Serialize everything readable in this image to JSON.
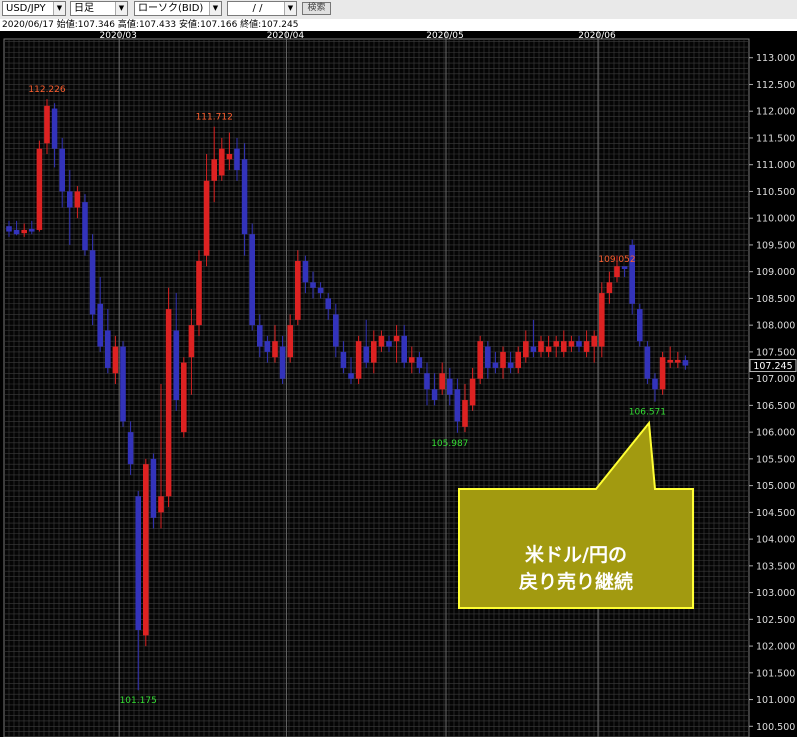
{
  "toolbar": {
    "symbol": "USD/JPY",
    "period": "日足",
    "chart_style": "ローソク(BID)",
    "date": "/ /",
    "search_label": "検索"
  },
  "info": {
    "date": "2020/06/17",
    "open_label": "始値:",
    "open": "107.346",
    "high_label": "高値:",
    "high": "107.433",
    "low_label": "安値:",
    "low": "107.166",
    "close_label": "終値:",
    "close": "107.245"
  },
  "callout": {
    "line1": "米ドル/円の",
    "line2": "戻り売り継続"
  },
  "colors": {
    "up": "#dd2222",
    "down": "#3333bb",
    "high_label": "#ff6030",
    "low_label": "#33dd33",
    "callout_bg": "#a29a10",
    "callout_border": "#ffff33",
    "grid": "#3c3c3c",
    "month_line": "#6a6a6a"
  },
  "chart_data": {
    "type": "candlestick",
    "xlabel": "",
    "ylabel": "",
    "grid": true,
    "ylim": [
      100.3,
      113.35
    ],
    "y_ticks": [
      "113.000",
      "112.500",
      "112.000",
      "111.500",
      "111.000",
      "110.500",
      "110.000",
      "109.500",
      "109.000",
      "108.500",
      "108.000",
      "107.500",
      "107.000",
      "106.500",
      "106.000",
      "105.500",
      "105.000",
      "104.500",
      "104.000",
      "103.500",
      "103.000",
      "102.500",
      "102.000",
      "101.500",
      "101.000",
      "100.500"
    ],
    "month_labels": [
      {
        "label": "2020/03",
        "index": 15
      },
      {
        "label": "2020/04",
        "index": 37
      },
      {
        "label": "2020/05",
        "index": 58
      },
      {
        "label": "2020/06",
        "index": 78
      }
    ],
    "last_price": "107.245",
    "annotations": [
      {
        "text": "112.226",
        "index": 5,
        "value": 112.226,
        "kind": "high"
      },
      {
        "text": "111.712",
        "index": 27,
        "value": 111.712,
        "kind": "high"
      },
      {
        "text": "109.052",
        "index": 80,
        "value": 109.052,
        "kind": "high"
      },
      {
        "text": "101.175",
        "index": 17,
        "value": 101.175,
        "kind": "low"
      },
      {
        "text": "105.987",
        "index": 58,
        "value": 105.987,
        "kind": "low"
      },
      {
        "text": "106.571",
        "index": 84,
        "value": 106.571,
        "kind": "low"
      }
    ],
    "candles": [
      {
        "o": 109.85,
        "h": 109.95,
        "l": 109.65,
        "c": 109.75
      },
      {
        "o": 109.78,
        "h": 109.95,
        "l": 109.68,
        "c": 109.7
      },
      {
        "o": 109.72,
        "h": 109.9,
        "l": 109.65,
        "c": 109.78
      },
      {
        "o": 109.8,
        "h": 109.95,
        "l": 109.7,
        "c": 109.75
      },
      {
        "o": 109.78,
        "h": 111.45,
        "l": 109.75,
        "c": 111.3
      },
      {
        "o": 111.4,
        "h": 112.226,
        "l": 111.2,
        "c": 112.1
      },
      {
        "o": 112.05,
        "h": 112.15,
        "l": 110.95,
        "c": 111.3
      },
      {
        "o": 111.3,
        "h": 111.5,
        "l": 110.2,
        "c": 110.5
      },
      {
        "o": 110.5,
        "h": 110.9,
        "l": 109.5,
        "c": 110.2
      },
      {
        "o": 110.2,
        "h": 110.6,
        "l": 110.0,
        "c": 110.5
      },
      {
        "o": 110.3,
        "h": 110.45,
        "l": 109.3,
        "c": 109.4
      },
      {
        "o": 109.4,
        "h": 109.7,
        "l": 108.0,
        "c": 108.2
      },
      {
        "o": 108.4,
        "h": 108.9,
        "l": 107.5,
        "c": 107.6
      },
      {
        "o": 107.9,
        "h": 108.3,
        "l": 107.1,
        "c": 107.2
      },
      {
        "o": 107.1,
        "h": 107.8,
        "l": 106.9,
        "c": 107.6
      },
      {
        "o": 107.6,
        "h": 107.7,
        "l": 106.1,
        "c": 106.2
      },
      {
        "o": 106.0,
        "h": 106.2,
        "l": 105.2,
        "c": 105.4
      },
      {
        "o": 104.8,
        "h": 104.9,
        "l": 101.175,
        "c": 102.3
      },
      {
        "o": 102.2,
        "h": 105.5,
        "l": 102.0,
        "c": 105.4
      },
      {
        "o": 105.5,
        "h": 105.6,
        "l": 104.2,
        "c": 104.4
      },
      {
        "o": 104.5,
        "h": 106.9,
        "l": 104.2,
        "c": 104.8
      },
      {
        "o": 104.8,
        "h": 108.7,
        "l": 104.6,
        "c": 108.3
      },
      {
        "o": 107.9,
        "h": 108.6,
        "l": 106.4,
        "c": 106.6
      },
      {
        "o": 106.0,
        "h": 107.4,
        "l": 105.9,
        "c": 107.3
      },
      {
        "o": 107.4,
        "h": 108.3,
        "l": 106.7,
        "c": 108.0
      },
      {
        "o": 108.0,
        "h": 109.4,
        "l": 107.8,
        "c": 109.2
      },
      {
        "o": 109.3,
        "h": 111.2,
        "l": 109.1,
        "c": 110.7
      },
      {
        "o": 110.7,
        "h": 111.712,
        "l": 110.3,
        "c": 111.1
      },
      {
        "o": 110.8,
        "h": 111.5,
        "l": 110.7,
        "c": 111.3
      },
      {
        "o": 111.1,
        "h": 111.6,
        "l": 110.9,
        "c": 111.2
      },
      {
        "o": 111.3,
        "h": 111.5,
        "l": 110.7,
        "c": 110.9
      },
      {
        "o": 111.1,
        "h": 111.4,
        "l": 109.3,
        "c": 109.7
      },
      {
        "o": 109.7,
        "h": 109.9,
        "l": 107.9,
        "c": 108.0
      },
      {
        "o": 108.0,
        "h": 108.2,
        "l": 107.4,
        "c": 107.6
      },
      {
        "o": 107.7,
        "h": 107.8,
        "l": 107.3,
        "c": 107.5
      },
      {
        "o": 107.4,
        "h": 108.0,
        "l": 107.3,
        "c": 107.7
      },
      {
        "o": 107.6,
        "h": 107.8,
        "l": 106.9,
        "c": 107.0
      },
      {
        "o": 107.4,
        "h": 108.2,
        "l": 107.3,
        "c": 108.0
      },
      {
        "o": 108.1,
        "h": 109.4,
        "l": 108.0,
        "c": 109.2
      },
      {
        "o": 109.2,
        "h": 109.3,
        "l": 108.6,
        "c": 108.8
      },
      {
        "o": 108.8,
        "h": 109.0,
        "l": 108.5,
        "c": 108.7
      },
      {
        "o": 108.7,
        "h": 108.8,
        "l": 108.5,
        "c": 108.6
      },
      {
        "o": 108.5,
        "h": 108.6,
        "l": 108.1,
        "c": 108.3
      },
      {
        "o": 108.2,
        "h": 108.4,
        "l": 107.4,
        "c": 107.6
      },
      {
        "o": 107.5,
        "h": 107.7,
        "l": 107.1,
        "c": 107.2
      },
      {
        "o": 107.1,
        "h": 107.4,
        "l": 106.9,
        "c": 107.0
      },
      {
        "o": 107.0,
        "h": 107.8,
        "l": 106.9,
        "c": 107.7
      },
      {
        "o": 107.6,
        "h": 108.1,
        "l": 107.2,
        "c": 107.3
      },
      {
        "o": 107.3,
        "h": 107.9,
        "l": 107.1,
        "c": 107.7
      },
      {
        "o": 107.6,
        "h": 107.9,
        "l": 107.5,
        "c": 107.8
      },
      {
        "o": 107.7,
        "h": 107.8,
        "l": 107.5,
        "c": 107.6
      },
      {
        "o": 107.7,
        "h": 108.0,
        "l": 107.3,
        "c": 107.8
      },
      {
        "o": 107.8,
        "h": 108.0,
        "l": 107.2,
        "c": 107.3
      },
      {
        "o": 107.3,
        "h": 107.6,
        "l": 107.1,
        "c": 107.4
      },
      {
        "o": 107.4,
        "h": 107.5,
        "l": 107.1,
        "c": 107.2
      },
      {
        "o": 107.1,
        "h": 107.3,
        "l": 106.5,
        "c": 106.8
      },
      {
        "o": 106.8,
        "h": 107.1,
        "l": 106.5,
        "c": 106.6
      },
      {
        "o": 106.8,
        "h": 107.3,
        "l": 106.7,
        "c": 107.1
      },
      {
        "o": 107.0,
        "h": 107.2,
        "l": 106.5,
        "c": 106.7
      },
      {
        "o": 106.8,
        "h": 107.0,
        "l": 105.987,
        "c": 106.2
      },
      {
        "o": 106.1,
        "h": 106.9,
        "l": 106.0,
        "c": 106.6
      },
      {
        "o": 106.5,
        "h": 107.2,
        "l": 106.4,
        "c": 107.0
      },
      {
        "o": 107.0,
        "h": 107.8,
        "l": 106.9,
        "c": 107.7
      },
      {
        "o": 107.6,
        "h": 107.7,
        "l": 107.0,
        "c": 107.2
      },
      {
        "o": 107.3,
        "h": 107.5,
        "l": 107.1,
        "c": 107.2
      },
      {
        "o": 107.2,
        "h": 107.6,
        "l": 107.0,
        "c": 107.5
      },
      {
        "o": 107.3,
        "h": 107.5,
        "l": 107.1,
        "c": 107.2
      },
      {
        "o": 107.2,
        "h": 107.6,
        "l": 107.1,
        "c": 107.5
      },
      {
        "o": 107.4,
        "h": 107.9,
        "l": 107.3,
        "c": 107.7
      },
      {
        "o": 107.6,
        "h": 108.1,
        "l": 107.4,
        "c": 107.5
      },
      {
        "o": 107.5,
        "h": 107.8,
        "l": 107.4,
        "c": 107.7
      },
      {
        "o": 107.5,
        "h": 107.8,
        "l": 107.4,
        "c": 107.6
      },
      {
        "o": 107.6,
        "h": 107.8,
        "l": 107.4,
        "c": 107.7
      },
      {
        "o": 107.5,
        "h": 107.9,
        "l": 107.4,
        "c": 107.7
      },
      {
        "o": 107.6,
        "h": 107.8,
        "l": 107.5,
        "c": 107.7
      },
      {
        "o": 107.7,
        "h": 107.8,
        "l": 107.5,
        "c": 107.6
      },
      {
        "o": 107.5,
        "h": 107.9,
        "l": 107.4,
        "c": 107.7
      },
      {
        "o": 107.6,
        "h": 107.9,
        "l": 107.3,
        "c": 107.8
      },
      {
        "o": 107.6,
        "h": 108.8,
        "l": 107.4,
        "c": 108.6
      },
      {
        "o": 108.6,
        "h": 109.0,
        "l": 108.4,
        "c": 108.8
      },
      {
        "o": 108.9,
        "h": 109.3,
        "l": 108.8,
        "c": 109.1
      },
      {
        "o": 109.1,
        "h": 109.052,
        "l": 108.9,
        "c": 109.05
      },
      {
        "o": 109.5,
        "h": 109.6,
        "l": 108.2,
        "c": 108.4
      },
      {
        "o": 108.3,
        "h": 108.4,
        "l": 107.6,
        "c": 107.7
      },
      {
        "o": 107.6,
        "h": 107.7,
        "l": 106.9,
        "c": 107.0
      },
      {
        "o": 107.0,
        "h": 107.1,
        "l": 106.571,
        "c": 106.8
      },
      {
        "o": 106.8,
        "h": 107.5,
        "l": 106.7,
        "c": 107.4
      },
      {
        "o": 107.3,
        "h": 107.6,
        "l": 107.2,
        "c": 107.35
      },
      {
        "o": 107.3,
        "h": 107.5,
        "l": 107.2,
        "c": 107.35
      },
      {
        "o": 107.346,
        "h": 107.433,
        "l": 107.166,
        "c": 107.245
      }
    ]
  }
}
